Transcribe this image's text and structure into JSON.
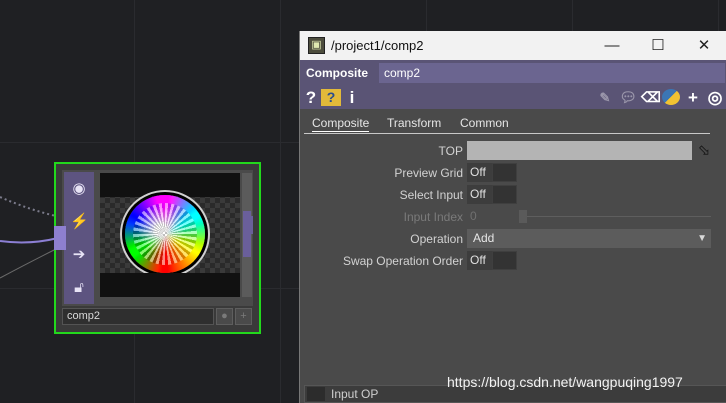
{
  "node": {
    "name": "comp2",
    "side_icons": [
      "viewer-icon",
      "bypass-icon",
      "display-arrow-icon",
      "lock-icon"
    ]
  },
  "window": {
    "title": "/project1/comp2",
    "minimize": "—",
    "maximize": "☐",
    "close": "✕"
  },
  "header": {
    "type_label": "Composite",
    "name_value": "comp2"
  },
  "toolbar": {
    "help": "?",
    "help_py": "?",
    "info": "i"
  },
  "tabs": [
    {
      "label": "Composite",
      "active": true
    },
    {
      "label": "Transform",
      "active": false
    },
    {
      "label": "Common",
      "active": false
    }
  ],
  "params": {
    "top": {
      "label": "TOP",
      "value": ""
    },
    "preview_grid": {
      "label": "Preview Grid",
      "value": "Off"
    },
    "select_input": {
      "label": "Select Input",
      "value": "Off"
    },
    "input_index": {
      "label": "Input Index",
      "value": "0"
    },
    "operation": {
      "label": "Operation",
      "value": "Add"
    },
    "swap_order": {
      "label": "Swap Operation Order",
      "value": "Off"
    }
  },
  "bottom": {
    "label": "Input OP"
  },
  "watermark": "https://blog.csdn.net/wangpuqing1997",
  "colors": {
    "selection": "#22d81c",
    "node_purple": "#5d5480",
    "header_purple": "#5a5475"
  }
}
